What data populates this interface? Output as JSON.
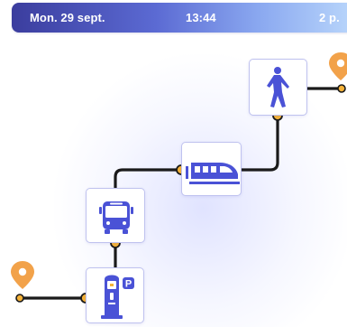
{
  "status_bar": {
    "date": "Mon. 29 sept.",
    "time": "13:44",
    "extra": "2 p."
  },
  "route": {
    "segments": [
      {
        "mode": "parking",
        "icon": "parking-meter-icon"
      },
      {
        "mode": "bus",
        "icon": "bus-icon"
      },
      {
        "mode": "train",
        "icon": "train-icon"
      },
      {
        "mode": "walk",
        "icon": "walking-person-icon"
      }
    ],
    "origin_icon": "location-pin-icon",
    "destination_icon": "location-pin-icon",
    "parking_sign": "P"
  },
  "colors": {
    "accent_blue": "#4a52d6",
    "pin_orange": "#f2a24a",
    "node_orange": "#f5b238",
    "route_line": "#1a1a1a",
    "card_border": "#bfc2ef"
  }
}
